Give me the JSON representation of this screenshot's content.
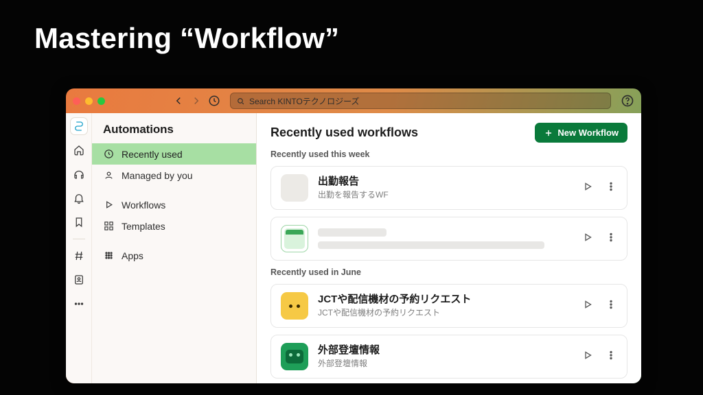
{
  "slide": {
    "title": "Mastering “Workflow”"
  },
  "topbar": {
    "search_placeholder": "Search KINTOテクノロジーズ"
  },
  "sidebar": {
    "title": "Automations",
    "items": [
      {
        "label": "Recently used"
      },
      {
        "label": "Managed by you"
      },
      {
        "label": "Workflows"
      },
      {
        "label": "Templates"
      },
      {
        "label": "Apps"
      }
    ]
  },
  "main": {
    "title": "Recently used workflows",
    "new_button": "New Workflow",
    "groups": [
      {
        "label": "Recently used this week",
        "items": [
          {
            "name": "出勤報告",
            "desc": "出勤を報告するWF"
          },
          {
            "name": "",
            "desc": ""
          }
        ]
      },
      {
        "label": "Recently used in June",
        "items": [
          {
            "name": "JCTや配信機材の予約リクエスト",
            "desc": "JCTや配信機材の予約リクエスト"
          },
          {
            "name": "外部登壇情報",
            "desc": "外部登壇情報"
          }
        ]
      }
    ]
  }
}
